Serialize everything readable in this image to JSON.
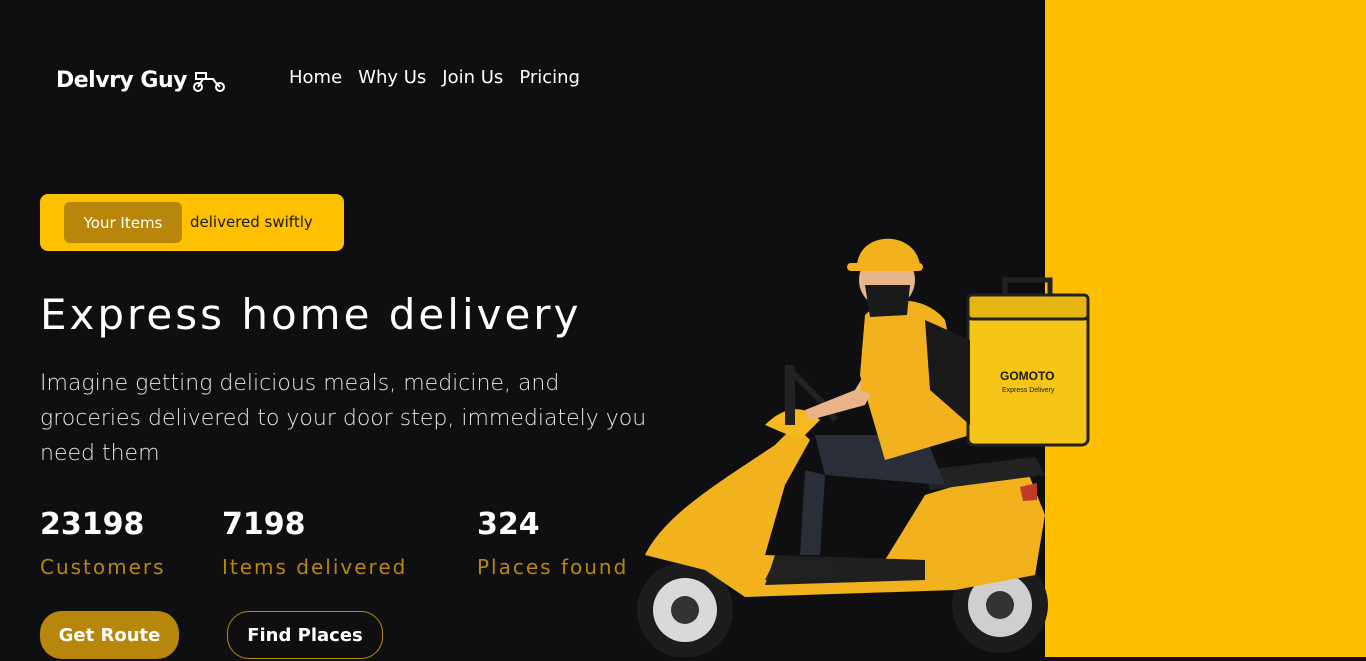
{
  "colors": {
    "background": "#0f0f12",
    "accent": "#ffbf00",
    "gold": "#b8860b"
  },
  "header": {
    "logo_text": "Delvry Guy",
    "logo_icon": "scooter-icon",
    "nav": [
      {
        "label": "Home"
      },
      {
        "label": "Why Us"
      },
      {
        "label": "Join Us"
      },
      {
        "label": "Pricing"
      }
    ]
  },
  "hero": {
    "badge_pill": "Your Items",
    "badge_text": "delivered swiftly",
    "headline": "Express home delivery",
    "subtitle": "Imagine getting delicious meals, medicine, and groceries delivered to your door step, immediately you need them",
    "stats": [
      {
        "value": "23198",
        "label": "Customers"
      },
      {
        "value": "7198",
        "label": "Items delivered"
      },
      {
        "value": "324",
        "label": "Places found"
      }
    ],
    "primary_button": "Get Route",
    "secondary_button": "Find Places"
  },
  "illustration": {
    "bag_brand": "GOMOTO",
    "bag_tagline": "Express Delivery"
  }
}
